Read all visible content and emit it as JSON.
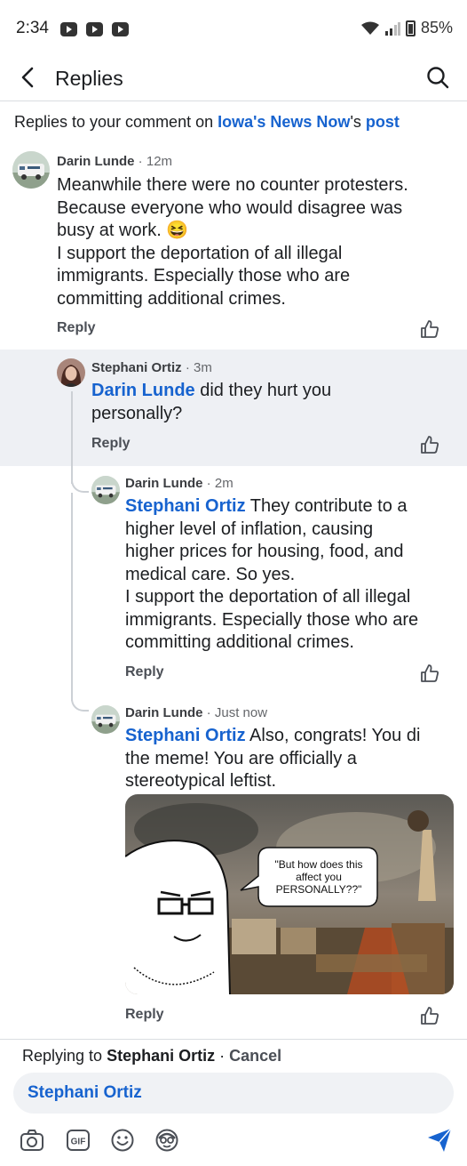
{
  "status_bar": {
    "time": "2:34",
    "battery": "85%"
  },
  "header": {
    "title": "Replies"
  },
  "context": {
    "prefix": "Replies to your comment on ",
    "page_name": "Iowa's News Now",
    "possessive": "'s ",
    "post_word": "post"
  },
  "comments": [
    {
      "author": "Darin Lunde",
      "time": "12m",
      "mention": "",
      "lines": [
        "Meanwhile there were no counter protesters.",
        "Because everyone who would disagree was",
        "busy at work. 😆",
        "I support the deportation of all illegal",
        "immigrants. Especially those who are",
        "committing additional crimes."
      ],
      "reply_label": "Reply"
    },
    {
      "author": "Stephani Ortiz",
      "time": "3m",
      "mention": "Darin Lunde",
      "lines": [
        " did they hurt you",
        "personally?"
      ],
      "reply_label": "Reply"
    },
    {
      "author": "Darin Lunde",
      "time": "2m",
      "mention": "Stephani Ortiz",
      "lines": [
        " They contribute to a",
        "higher level of inflation, causing",
        "higher prices for housing, food, and",
        "medical care. So yes.",
        "I support the deportation of all illegal",
        "immigrants. Especially those who are",
        "committing additional crimes."
      ],
      "reply_label": "Reply"
    },
    {
      "author": "Darin Lunde",
      "time": "Just now",
      "mention": "Stephani Ortiz",
      "lines": [
        " Also, congrats! You di",
        "the meme! You are officially a",
        "stereotypical leftist."
      ],
      "reply_label": "Reply",
      "meme_caption": "\"But how does this affect you PERSONALLY??\""
    }
  ],
  "composer": {
    "replying_prefix": "Replying to ",
    "replying_name": "Stephani Ortiz",
    "separator": " · ",
    "cancel_label": "Cancel",
    "input_value": "Stephani Ortiz"
  },
  "meta_separator": " · ",
  "colors": {
    "link": "#1763cf",
    "highlight": "#eef0f4",
    "send": "#1763cf"
  },
  "icons": [
    "back-icon",
    "search-icon",
    "like-icon",
    "camera-icon",
    "gif-icon",
    "emoji-icon",
    "avatar-sticker-icon",
    "send-icon"
  ]
}
